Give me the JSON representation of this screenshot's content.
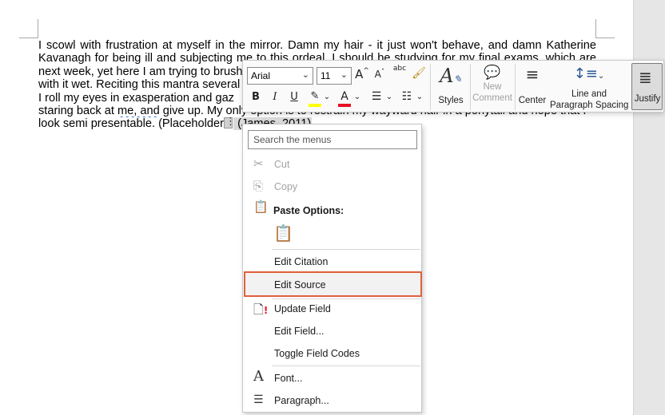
{
  "document": {
    "lines": [
      "I scowl with frustration at myself in the mirror. Damn my hair - it just won't behave, and damn Katherine",
      "Kavanagh for being ill and subjecting me to this ordeal. I should be studying for my final exams, which are",
      "next week, yet here I am trying to brush",
      "with it wet. Reciting this mantra several",
      "I roll my eyes in exasperation and gaz",
      "staring back at",
      "look semi presentable. (Placeholder"
    ],
    "line6_wavy": "me, and",
    "line6_rest": " give up. My only option is to restrain my wayward hair in a ponytail and hope that I",
    "field_text": " (James, 2011)"
  },
  "mini_toolbar": {
    "font_name": "Arial",
    "font_size": "11",
    "grow_font": "A",
    "shrink_font": "A",
    "clear_format": "abc",
    "bold": "B",
    "italic": "I",
    "underline": "U",
    "font_color_glyph": "A",
    "styles_label": "Styles",
    "new_comment_line1": "New",
    "new_comment_line2": "Comment",
    "center_label": "Center",
    "line_spacing_line1": "Line and",
    "line_spacing_line2": "Paragraph Spacing",
    "justify_label": "Justify",
    "highlight_color": "#ffff00",
    "font_color": "#e81123"
  },
  "context_menu": {
    "search_placeholder": "Search the menus",
    "cut": "Cut",
    "copy": "Copy",
    "paste_options": "Paste Options:",
    "edit_citation": "Edit Citation",
    "edit_source": "Edit Source",
    "update_field": "Update Field",
    "edit_field": "Edit Field...",
    "toggle_field_codes": "Toggle Field Codes",
    "font": "Font...",
    "paragraph": "Paragraph..."
  },
  "colors": {
    "highlight_border": "#e0603c"
  }
}
